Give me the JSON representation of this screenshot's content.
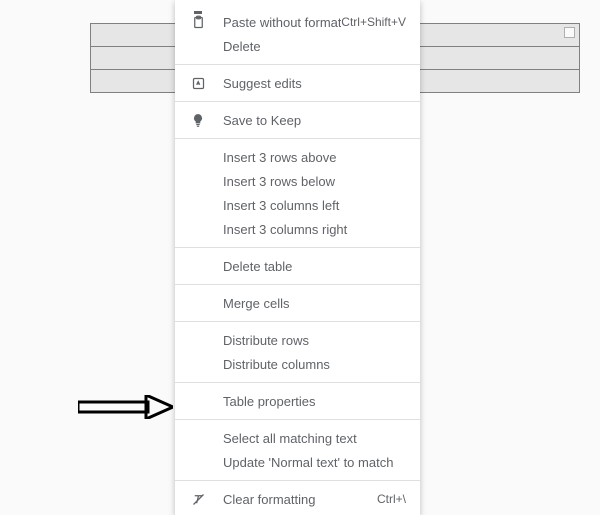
{
  "menu": {
    "paste_without_formatting": {
      "label": "Paste without formatting",
      "shortcut": "Ctrl+Shift+V"
    },
    "delete": {
      "label": "Delete"
    },
    "suggest_edits": {
      "label": "Suggest edits"
    },
    "save_to_keep": {
      "label": "Save to Keep"
    },
    "insert_rows_above": {
      "label": "Insert 3 rows above"
    },
    "insert_rows_below": {
      "label": "Insert 3 rows below"
    },
    "insert_cols_left": {
      "label": "Insert 3 columns left"
    },
    "insert_cols_right": {
      "label": "Insert 3 columns right"
    },
    "delete_table": {
      "label": "Delete table"
    },
    "merge_cells": {
      "label": "Merge cells"
    },
    "distribute_rows": {
      "label": "Distribute rows"
    },
    "distribute_columns": {
      "label": "Distribute columns"
    },
    "table_properties": {
      "label": "Table properties"
    },
    "select_all_matching": {
      "label": "Select all matching text"
    },
    "update_normal_text": {
      "label": "Update 'Normal text' to match"
    },
    "clear_formatting": {
      "label": "Clear formatting",
      "shortcut": "Ctrl+\\"
    }
  }
}
